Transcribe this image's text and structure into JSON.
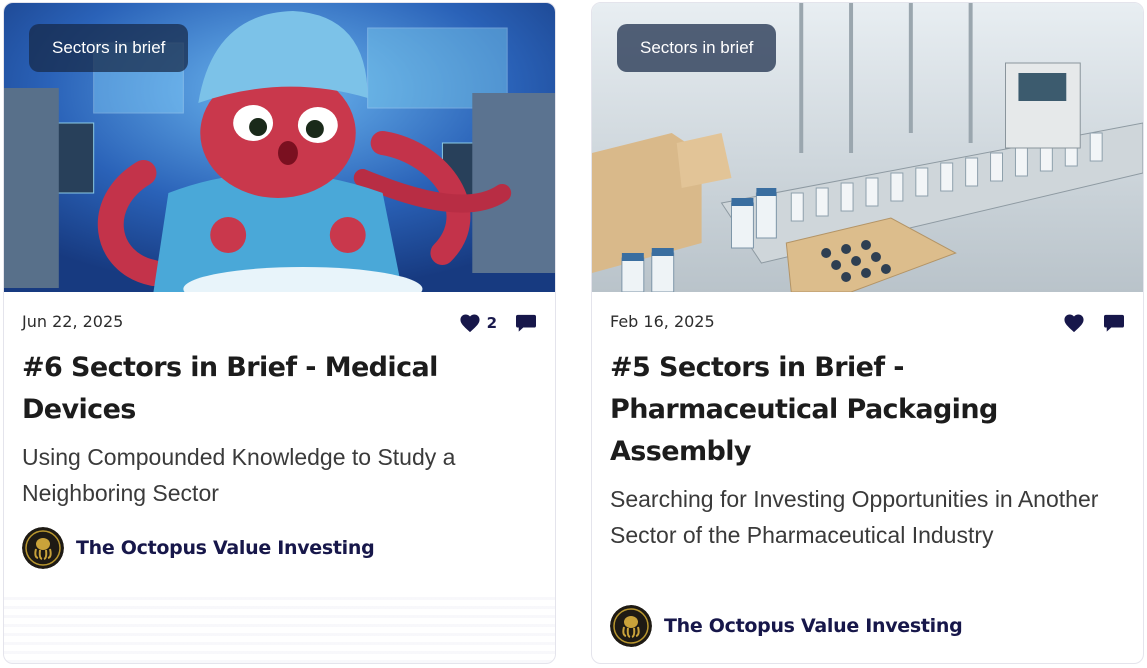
{
  "posts": [
    {
      "category": "Sectors in brief",
      "date": "Jun 22, 2025",
      "likes": "2",
      "title": "#6 Sectors in Brief - Medical Devices",
      "subtitle": "Using Compounded Knowledge to Study a Neighboring Sector",
      "author": "The Octopus Value Investing",
      "image_icon": "octopus-surgeon-illustration"
    },
    {
      "category": "Sectors in brief",
      "date": "Feb 16, 2025",
      "likes": "",
      "title": "#5 Sectors in Brief - Pharmaceutical Packaging Assembly",
      "subtitle": "Searching for Investing Opportunities in Another Sector of the Pharmaceutical Industry",
      "author": "The Octopus Value Investing",
      "image_icon": "pharma-factory-illustration"
    }
  ],
  "colors": {
    "accent": "#17174a",
    "badge_bg": "#16284688",
    "text": "#1c1c1c"
  },
  "icons": {
    "like": "heart-icon",
    "comment": "comment-icon"
  }
}
